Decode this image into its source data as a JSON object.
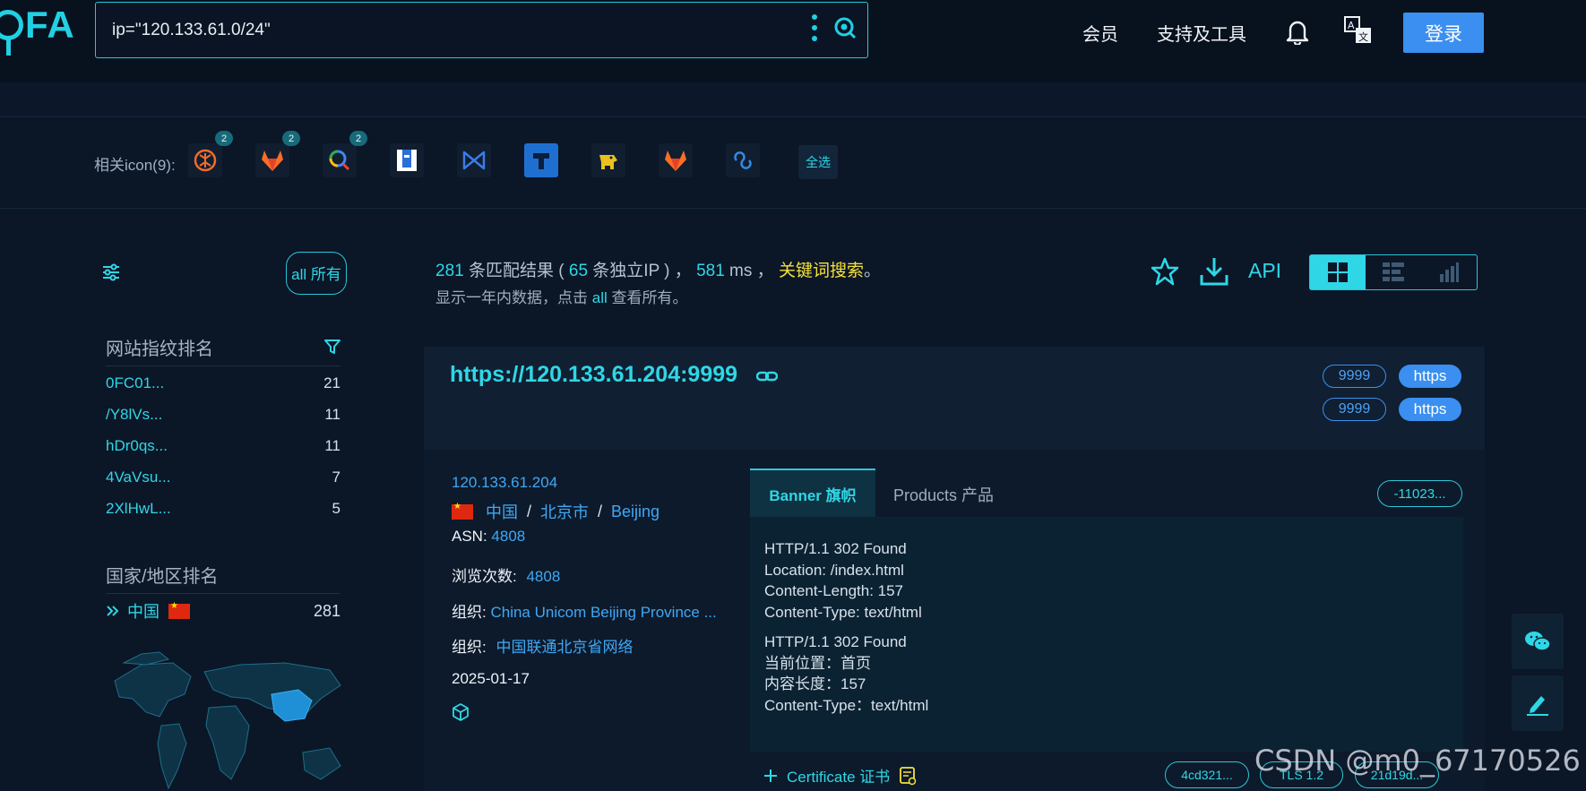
{
  "header": {
    "logo_text": "FA",
    "search_value": "ip=\"120.133.61.0/24\"",
    "nav": [
      "会员",
      "支持及工具"
    ],
    "login_label": "登录"
  },
  "icons_row": {
    "label": "相关icon(9):",
    "badges": [
      "2",
      "2",
      "2"
    ],
    "select_all": "全选"
  },
  "sidebar": {
    "all_label": "all 所有",
    "fingerprint_title": "网站指纹排名",
    "fingerprints": [
      {
        "name": "0FC01...",
        "count": "21"
      },
      {
        "name": "/Y8lVs...",
        "count": "11"
      },
      {
        "name": "hDr0qs...",
        "count": "11"
      },
      {
        "name": "4VaVsu...",
        "count": "7"
      },
      {
        "name": "2XlHwL...",
        "count": "5"
      }
    ],
    "country_title": "国家/地区排名",
    "country": {
      "name": "中国",
      "count": "281"
    }
  },
  "results": {
    "count": "281",
    "count_suffix": " 条匹配结果 (",
    "unique_ip": "65",
    "unique_ip_suffix": " 条独立IP ) ，",
    "time": "581",
    "time_suffix": " ms ，",
    "keyword_search": "关键词搜索",
    "period": "。",
    "sub_prefix": "显示一年内数据，点击 ",
    "sub_all": "all",
    "sub_suffix": " 查看所有。",
    "api_label": "API"
  },
  "card": {
    "url": "https://120.133.61.204:9999",
    "ports": [
      {
        "port": "9999",
        "protocol": "https"
      },
      {
        "port": "9999",
        "protocol": "https"
      }
    ],
    "ip": "120.133.61.204",
    "country": "中国",
    "city": "北京市",
    "region": "Beijing",
    "asn_label": "ASN:",
    "asn": "4808",
    "views_label": "浏览次数:",
    "views": "4808",
    "org_label": "组织:",
    "org_en": "China Unicom Beijing Province ...",
    "org_label_2": "组织:",
    "org_cn": "中国联通北京省网络",
    "date": "2025-01-17",
    "tab_banner": "Banner 旗帜",
    "tab_products": "Products 产品",
    "hash": "-11023...",
    "banner_block1": [
      "HTTP/1.1 302 Found",
      "Location: /index.html",
      "Content-Length: 157",
      "Content-Type: text/html"
    ],
    "banner_block2": [
      "HTTP/1.1 302 Found",
      "当前位置：首页",
      "内容长度：157",
      "Content-Type：text/html"
    ],
    "cert_label": "Certificate 证书",
    "cert_pills": [
      "4cd321...",
      "TLS 1.2",
      "21d19d..."
    ]
  },
  "watermark": "CSDN @m0_67170526",
  "colors": {
    "accent": "#2fd7e6",
    "link": "#3fa8f5",
    "primary": "#3a8ff0",
    "highlight": "#f5e23b",
    "background": "#0b1627"
  }
}
